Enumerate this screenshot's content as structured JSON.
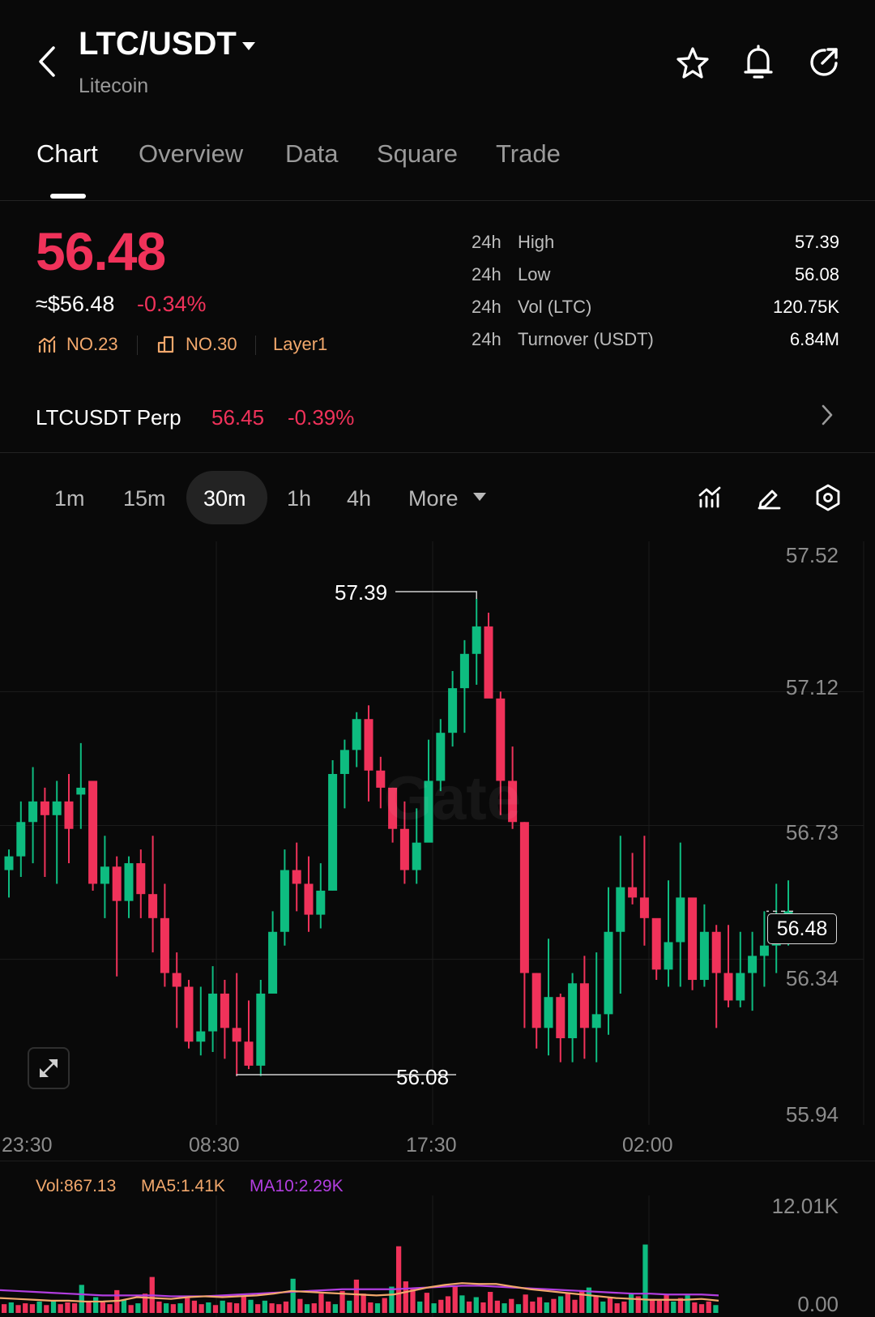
{
  "header": {
    "pair": "LTC/USDT",
    "name": "Litecoin",
    "icons": [
      "back-arrow-icon",
      "caret-down-icon",
      "star-icon",
      "bell-icon",
      "share-icon"
    ]
  },
  "tabs": [
    {
      "label": "Chart",
      "active": true
    },
    {
      "label": "Overview",
      "active": false
    },
    {
      "label": "Data",
      "active": false
    },
    {
      "label": "Square",
      "active": false
    },
    {
      "label": "Trade",
      "active": false
    }
  ],
  "price": {
    "last": "56.48",
    "usd": "≈$56.48",
    "change": "-0.34%",
    "rank1": "NO.23",
    "rank2": "NO.30",
    "category": "Layer1"
  },
  "stats": [
    {
      "prefix": "24h",
      "label": "High",
      "value": "57.39"
    },
    {
      "prefix": "24h",
      "label": "Low",
      "value": "56.08"
    },
    {
      "prefix": "24h",
      "label": "Vol (LTC)",
      "value": "120.75K"
    },
    {
      "prefix": "24h",
      "label": "Turnover (USDT)",
      "value": "6.84M"
    }
  ],
  "perp": {
    "name": "LTCUSDT Perp",
    "price": "56.45",
    "change": "-0.39%"
  },
  "timeframes": [
    {
      "label": "1m",
      "active": false
    },
    {
      "label": "15m",
      "active": false
    },
    {
      "label": "30m",
      "active": true
    },
    {
      "label": "1h",
      "active": false
    },
    {
      "label": "4h",
      "active": false
    }
  ],
  "more_label": "More",
  "colors": {
    "up": "#0ebc80",
    "down": "#f0325a",
    "bg": "#090909",
    "accent_orange": "#f2a86c",
    "ma10": "#b23ee0"
  },
  "chart_data": {
    "type": "candlestick",
    "price_axis": [
      "57.52",
      "57.12",
      "56.73",
      "56.34",
      "55.94"
    ],
    "ylim": [
      55.94,
      57.52
    ],
    "time_labels": [
      "23:30",
      "08:30",
      "17:30",
      "02:00"
    ],
    "high_label": "57.39",
    "low_label": "56.08",
    "current_price": "56.48",
    "watermark": "Gate",
    "candles": [
      [
        56.6,
        56.64,
        56.52,
        56.66
      ],
      [
        56.64,
        56.74,
        56.58,
        56.8
      ],
      [
        56.74,
        56.8,
        56.62,
        56.9
      ],
      [
        56.8,
        56.76,
        56.58,
        56.84
      ],
      [
        56.76,
        56.8,
        56.56,
        56.86
      ],
      [
        56.8,
        56.72,
        56.62,
        56.88
      ],
      [
        56.82,
        56.84,
        56.72,
        56.97
      ],
      [
        56.86,
        56.56,
        56.54,
        56.86
      ],
      [
        56.56,
        56.61,
        56.46,
        56.7
      ],
      [
        56.61,
        56.51,
        56.29,
        56.64
      ],
      [
        56.51,
        56.62,
        56.46,
        56.64
      ],
      [
        56.62,
        56.53,
        56.46,
        56.66
      ],
      [
        56.53,
        56.46,
        56.36,
        56.7
      ],
      [
        56.46,
        56.3,
        56.26,
        56.56
      ],
      [
        56.3,
        56.26,
        56.14,
        56.36
      ],
      [
        56.26,
        56.1,
        56.08,
        56.28
      ],
      [
        56.1,
        56.13,
        56.06,
        56.26
      ],
      [
        56.13,
        56.24,
        56.07,
        56.32
      ],
      [
        56.24,
        56.14,
        56.05,
        56.28
      ],
      [
        56.14,
        56.1,
        56.0,
        56.3
      ],
      [
        56.1,
        56.03,
        56.02,
        56.22
      ],
      [
        56.03,
        56.24,
        56.0,
        56.28
      ],
      [
        56.24,
        56.42,
        56.3,
        56.48
      ],
      [
        56.42,
        56.6,
        56.38,
        56.66
      ],
      [
        56.6,
        56.56,
        56.48,
        56.68
      ],
      [
        56.56,
        56.47,
        56.42,
        56.64
      ],
      [
        56.47,
        56.54,
        56.43,
        56.62
      ],
      [
        56.54,
        56.88,
        56.54,
        56.92
      ],
      [
        56.88,
        56.95,
        56.78,
        56.98
      ],
      [
        56.95,
        57.04,
        56.9,
        57.06
      ],
      [
        57.04,
        56.89,
        56.8,
        57.08
      ],
      [
        56.89,
        56.84,
        56.78,
        56.93
      ],
      [
        56.84,
        56.72,
        56.68,
        56.84
      ],
      [
        56.72,
        56.6,
        56.56,
        56.8
      ],
      [
        56.6,
        56.68,
        56.56,
        56.78
      ],
      [
        56.68,
        56.86,
        56.69,
        56.98
      ],
      [
        56.86,
        57.0,
        56.83,
        57.04
      ],
      [
        57.0,
        57.13,
        56.96,
        57.18
      ],
      [
        57.13,
        57.23,
        57.0,
        57.27
      ],
      [
        57.23,
        57.31,
        57.14,
        57.39
      ],
      [
        57.31,
        57.1,
        57.16,
        57.35
      ],
      [
        57.1,
        56.86,
        56.76,
        57.12
      ],
      [
        56.86,
        56.74,
        56.72,
        56.96
      ],
      [
        56.74,
        56.3,
        56.14,
        56.74
      ],
      [
        56.3,
        56.14,
        56.08,
        56.3
      ],
      [
        56.14,
        56.23,
        56.06,
        56.4
      ],
      [
        56.23,
        56.11,
        56.04,
        56.24
      ],
      [
        56.11,
        56.27,
        56.04,
        56.3
      ],
      [
        56.27,
        56.14,
        56.05,
        56.35
      ],
      [
        56.14,
        56.18,
        56.04,
        56.36
      ],
      [
        56.18,
        56.42,
        56.12,
        56.55
      ],
      [
        56.42,
        56.55,
        56.24,
        56.7
      ],
      [
        56.55,
        56.52,
        56.5,
        56.65
      ],
      [
        56.52,
        56.46,
        56.38,
        56.7
      ],
      [
        56.46,
        56.31,
        56.28,
        56.43
      ],
      [
        56.31,
        56.39,
        56.26,
        56.57
      ],
      [
        56.39,
        56.52,
        56.26,
        56.68
      ],
      [
        56.52,
        56.28,
        56.25,
        56.5
      ],
      [
        56.28,
        56.42,
        56.26,
        56.5
      ],
      [
        56.42,
        56.3,
        56.14,
        56.44
      ],
      [
        56.3,
        56.22,
        56.2,
        56.44
      ],
      [
        56.22,
        56.3,
        56.2,
        56.42
      ],
      [
        56.3,
        56.35,
        56.19,
        56.42
      ],
      [
        56.35,
        56.38,
        56.26,
        56.48
      ],
      [
        56.38,
        56.42,
        56.3,
        56.56
      ],
      [
        56.42,
        56.48,
        56.38,
        56.57
      ]
    ],
    "volume": {
      "axis": [
        "12.01K",
        "0.00"
      ],
      "max": 12010,
      "indicators": {
        "vol": "Vol:867.13",
        "ma5": "MA5:1.41K",
        "ma10": "MA10:2.29K"
      },
      "values": [
        1000,
        1200,
        900,
        1100,
        1000,
        1300,
        900,
        1400,
        1000,
        1200,
        1100,
        3200,
        1300,
        1800,
        1200,
        1000,
        2600,
        1500,
        900,
        1100,
        2200,
        4100,
        1300,
        1100,
        1000,
        1100,
        1700,
        1400,
        1000,
        1200,
        900,
        1400,
        1200,
        1100,
        1900,
        1500,
        1000,
        1400,
        1100,
        1000,
        1300,
        3900,
        1600,
        1000,
        1100,
        2200,
        1300,
        1000,
        2500,
        1400,
        3800,
        2200,
        1200,
        1100,
        1700,
        3000,
        7600,
        3600,
        2800,
        1300,
        2300,
        1100,
        1500,
        1900,
        3100,
        2000,
        1300,
        1800,
        1200,
        2400,
        1400,
        1100,
        1600,
        1000,
        2100,
        1300,
        1800,
        1200,
        1600,
        1900,
        2200,
        1500,
        2600,
        2900,
        2000,
        1300,
        1700,
        1100,
        1300,
        2200,
        1900,
        7800,
        1600,
        1400,
        2100,
        1300,
        1700,
        2000,
        1200,
        1000,
        1300,
        900
      ],
      "ma5": [
        1700,
        1600,
        1500,
        1400,
        1400,
        1300,
        1300,
        1400,
        1800,
        1700,
        1600,
        1800,
        1900,
        1800,
        1900,
        2000,
        2200,
        2500,
        2400,
        2300,
        2200,
        2100,
        2000,
        2100,
        2500,
        2900,
        3200,
        3400,
        3300,
        3300,
        3000,
        2700,
        2500,
        2300,
        2100,
        1900,
        1700,
        1600,
        1500,
        1500,
        1500,
        1600,
        1400
      ],
      "ma10": [
        2600,
        2500,
        2400,
        2300,
        2200,
        2100,
        2000,
        2000,
        2000,
        2000,
        1900,
        1900,
        1900,
        2000,
        2100,
        2200,
        2300,
        2400,
        2500,
        2600,
        2700,
        2700,
        2700,
        2700,
        2800,
        2900,
        3000,
        3100,
        3100,
        3000,
        2900,
        2800,
        2700,
        2600,
        2500,
        2400,
        2300,
        2200,
        2200,
        2100,
        2100,
        2100,
        2000
      ]
    }
  }
}
